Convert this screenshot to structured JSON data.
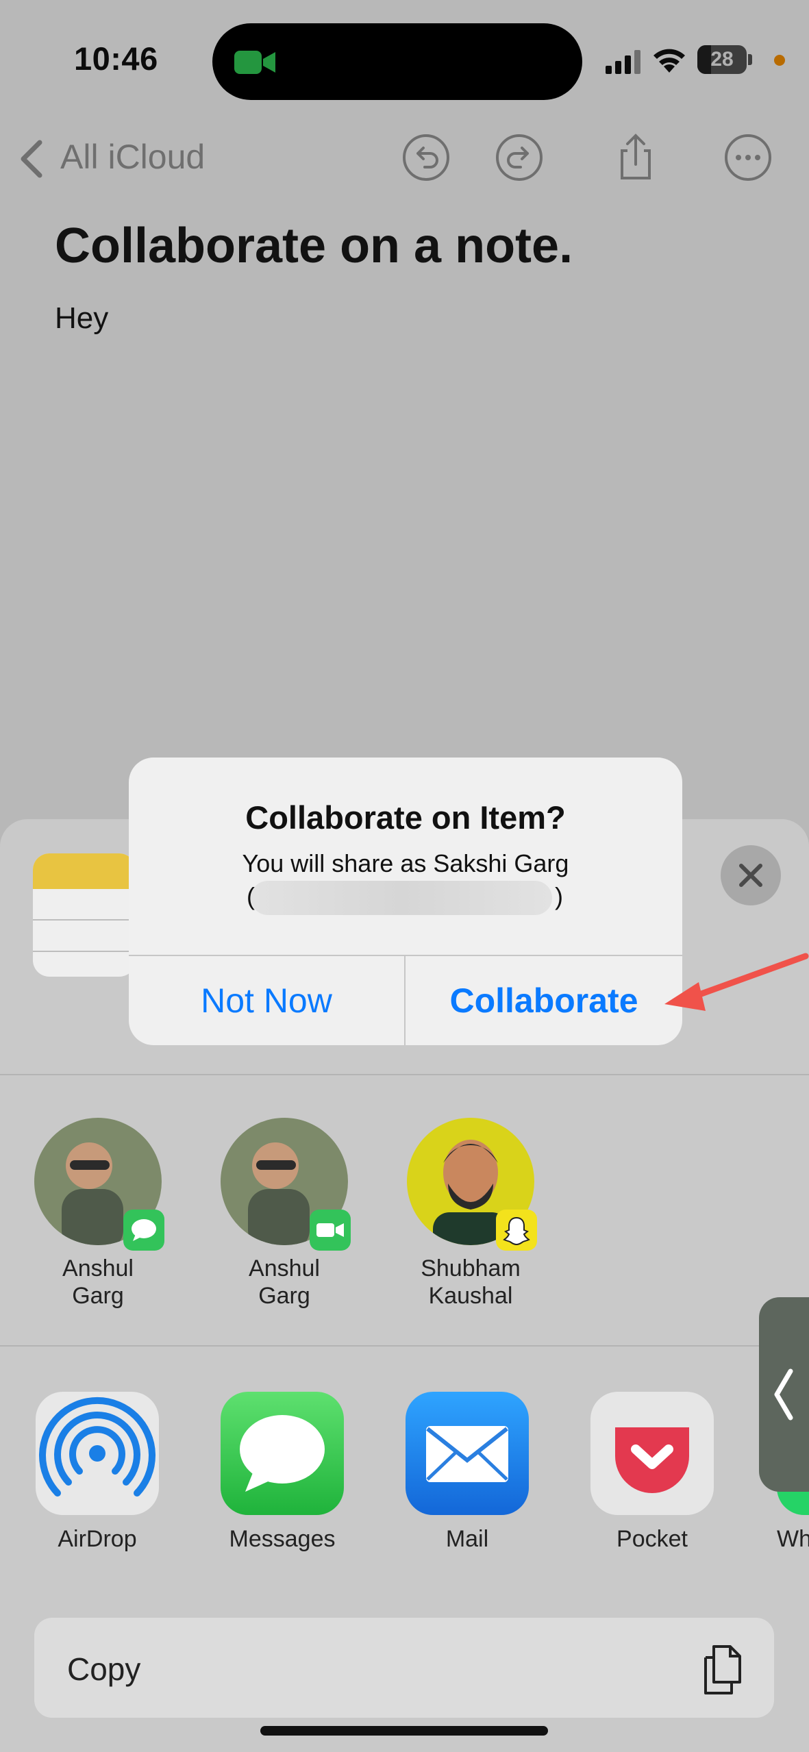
{
  "status_bar": {
    "time": "10:46",
    "battery_level": "28",
    "battery_fraction": 0.28,
    "icons": [
      "facetime-camera-icon",
      "cellular-signal-icon",
      "wifi-icon",
      "battery-icon",
      "privacy-indicator-dot"
    ]
  },
  "nav": {
    "back_label": "All iCloud",
    "actions": [
      "undo-icon",
      "redo-icon",
      "share-icon",
      "more-icon"
    ]
  },
  "note": {
    "title": "Collaborate on a note.",
    "body": "Hey"
  },
  "alert": {
    "title": "Collaborate on Item?",
    "message": "You will share as Sakshi Garg",
    "paren_open": "(",
    "paren_close": ")",
    "secondary_button": "Not Now",
    "primary_button": "Collaborate"
  },
  "share_sheet": {
    "people": [
      {
        "name": "Anshul\nGarg",
        "badge": "messages-badge-icon"
      },
      {
        "name": "Anshul\nGarg",
        "badge": "facetime-badge-icon"
      },
      {
        "name": "Shubham\nKaushal",
        "badge": "snapchat-badge-icon"
      }
    ],
    "apps": [
      {
        "label": "AirDrop",
        "icon": "airdrop-icon"
      },
      {
        "label": "Messages",
        "icon": "messages-icon"
      },
      {
        "label": "Mail",
        "icon": "mail-icon"
      },
      {
        "label": "Pocket",
        "icon": "pocket-icon"
      },
      {
        "label": "Wh",
        "icon": "whatsapp-icon"
      }
    ],
    "copy_label": "Copy"
  },
  "colors": {
    "accent": "#0a7aff",
    "annotation_arrow": "#f0524a",
    "notes_yellow": "#e8c441"
  }
}
